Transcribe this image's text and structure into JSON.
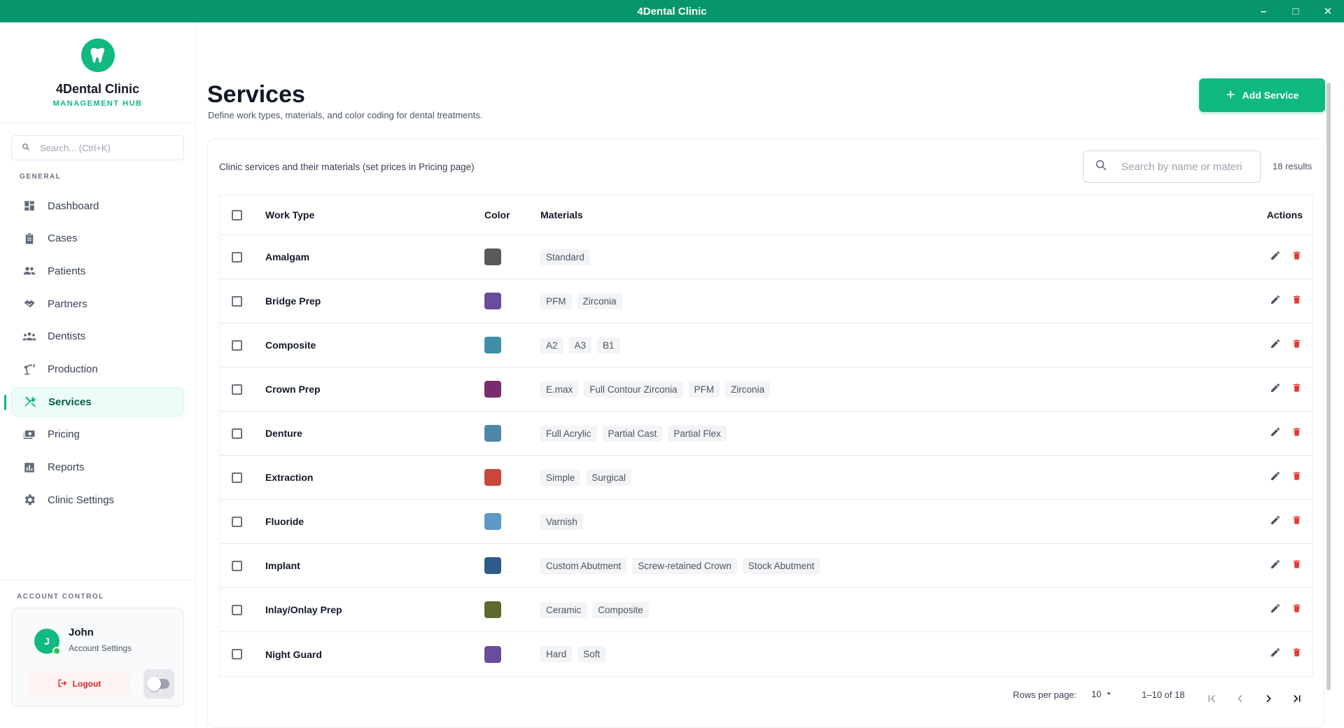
{
  "window": {
    "title": "4Dental Clinic"
  },
  "brand": {
    "name": "4Dental Clinic",
    "subtitle": "MANAGEMENT HUB"
  },
  "sidebar": {
    "search_placeholder": "Search... (Ctrl+K)",
    "section_general": "GENERAL",
    "items": [
      {
        "label": "Dashboard",
        "icon": "dashboard-icon"
      },
      {
        "label": "Cases",
        "icon": "clipboard-icon"
      },
      {
        "label": "Patients",
        "icon": "people-icon"
      },
      {
        "label": "Partners",
        "icon": "handshake-icon"
      },
      {
        "label": "Dentists",
        "icon": "group-icon"
      },
      {
        "label": "Production",
        "icon": "robot-arm-icon"
      },
      {
        "label": "Services",
        "icon": "tools-icon",
        "active": true
      },
      {
        "label": "Pricing",
        "icon": "payments-icon"
      },
      {
        "label": "Reports",
        "icon": "bar-chart-icon"
      },
      {
        "label": "Clinic Settings",
        "icon": "gear-icon"
      }
    ],
    "section_account": "ACCOUNT CONTROL",
    "account": {
      "initial": "J",
      "name": "John",
      "subtitle": "Account Settings",
      "logout_label": "Logout"
    }
  },
  "page": {
    "title": "Services",
    "subtitle": "Define work types, materials, and color coding for dental treatments.",
    "add_button": "Add Service",
    "caption": "Clinic services and their materials (set prices in Pricing page)",
    "search_placeholder": "Search by name or materi",
    "results": "18 results"
  },
  "table": {
    "headers": {
      "type": "Work Type",
      "color": "Color",
      "materials": "Materials",
      "actions": "Actions"
    },
    "rows": [
      {
        "type": "Amalgam",
        "color": "#5a5a5a",
        "materials": [
          "Standard"
        ]
      },
      {
        "type": "Bridge Prep",
        "color": "#6a4c9c",
        "materials": [
          "PFM",
          "Zirconia"
        ]
      },
      {
        "type": "Composite",
        "color": "#3f8fa8",
        "materials": [
          "A2",
          "A3",
          "B1"
        ]
      },
      {
        "type": "Crown Prep",
        "color": "#7a2a6f",
        "materials": [
          "E.max",
          "Full Contour Zirconia",
          "PFM",
          "Zirconia"
        ]
      },
      {
        "type": "Denture",
        "color": "#4f87a8",
        "materials": [
          "Full Acrylic",
          "Partial Cast",
          "Partial Flex"
        ]
      },
      {
        "type": "Extraction",
        "color": "#c8463a",
        "materials": [
          "Simple",
          "Surgical"
        ]
      },
      {
        "type": "Fluoride",
        "color": "#5e98c4",
        "materials": [
          "Varnish"
        ]
      },
      {
        "type": "Implant",
        "color": "#2e5a8c",
        "materials": [
          "Custom Abutment",
          "Screw-retained Crown",
          "Stock Abutment"
        ]
      },
      {
        "type": "Inlay/Onlay Prep",
        "color": "#5b6a2e",
        "materials": [
          "Ceramic",
          "Composite"
        ]
      },
      {
        "type": "Night Guard",
        "color": "#6a4c9c",
        "materials": [
          "Hard",
          "Soft"
        ]
      }
    ]
  },
  "pagination": {
    "rows_label": "Rows per page:",
    "rows_value": "10",
    "range": "1–10 of 18"
  },
  "colors": {
    "accent": "#10b981",
    "titlebar": "#079669",
    "danger": "#e53935"
  }
}
